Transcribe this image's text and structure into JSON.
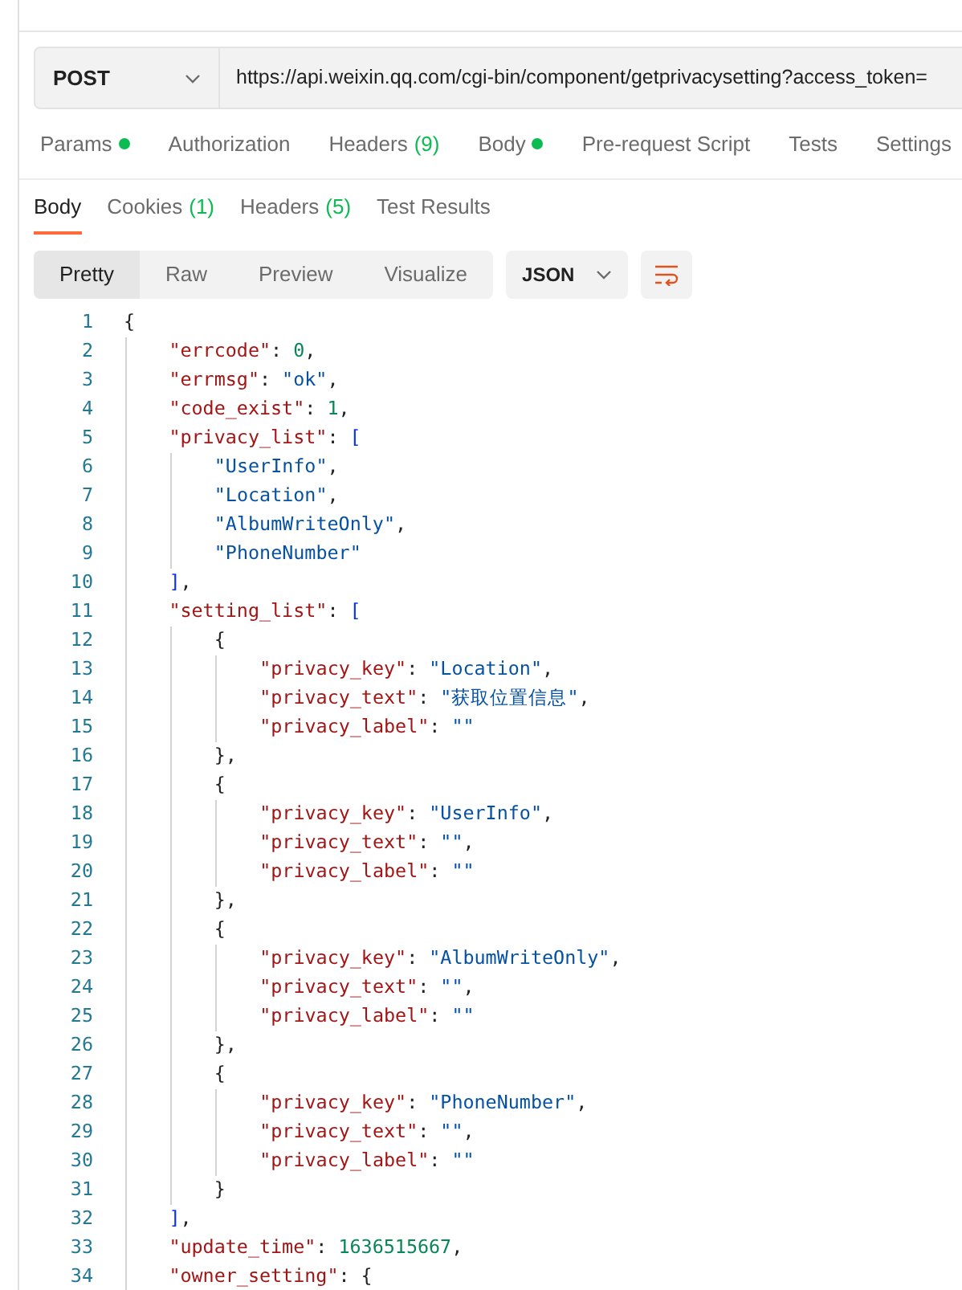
{
  "request": {
    "method": "POST",
    "url": "https://api.weixin.qq.com/cgi-bin/component/getprivacysetting?access_token="
  },
  "request_tabs": [
    {
      "label": "Params",
      "dot": true,
      "selected": false
    },
    {
      "label": "Authorization",
      "dot": false,
      "selected": false
    },
    {
      "label": "Headers",
      "count": "(9)",
      "dot": false,
      "selected": false
    },
    {
      "label": "Body",
      "dot": true,
      "selected": false
    },
    {
      "label": "Pre-request Script",
      "dot": false,
      "selected": false
    },
    {
      "label": "Tests",
      "dot": false,
      "selected": false
    },
    {
      "label": "Settings",
      "dot": false,
      "selected": false
    }
  ],
  "response_tabs": [
    {
      "label": "Body",
      "selected": true
    },
    {
      "label": "Cookies",
      "count": "(1)",
      "selected": false
    },
    {
      "label": "Headers",
      "count": "(5)",
      "selected": false
    },
    {
      "label": "Test Results",
      "selected": false
    }
  ],
  "view_modes": [
    {
      "label": "Pretty",
      "selected": true
    },
    {
      "label": "Raw",
      "selected": false
    },
    {
      "label": "Preview",
      "selected": false
    },
    {
      "label": "Visualize",
      "selected": false
    }
  ],
  "format": "JSON",
  "code_lines": [
    {
      "n": "1",
      "tokens": [
        {
          "kind": "punct",
          "text": "{"
        }
      ],
      "children": [
        {
          "n": "2",
          "tokens": [
            {
              "kind": "key",
              "text": "\"errcode\""
            },
            {
              "kind": "punct",
              "text": ":"
            },
            {
              "kind": "number",
              "text": "0"
            },
            {
              "kind": "punct",
              "text": ","
            }
          ]
        },
        {
          "n": "3",
          "tokens": [
            {
              "kind": "key",
              "text": "\"errmsg\""
            },
            {
              "kind": "punct",
              "text": ":"
            },
            {
              "kind": "string",
              "text": "\"ok\""
            },
            {
              "kind": "punct",
              "text": ","
            }
          ]
        },
        {
          "n": "4",
          "tokens": [
            {
              "kind": "key",
              "text": "\"code_exist\""
            },
            {
              "kind": "punct",
              "text": ":"
            },
            {
              "kind": "number",
              "text": "1"
            },
            {
              "kind": "punct",
              "text": ","
            }
          ]
        },
        {
          "n": "5",
          "tokens": [
            {
              "kind": "key",
              "text": "\"privacy_list\""
            },
            {
              "kind": "punct",
              "text": ":"
            },
            {
              "kind": "bracket",
              "text": "["
            }
          ],
          "children": [
            {
              "n": "6",
              "tokens": [
                {
                  "kind": "string",
                  "text": "\"UserInfo\""
                },
                {
                  "kind": "punct",
                  "text": ","
                }
              ]
            },
            {
              "n": "7",
              "tokens": [
                {
                  "kind": "string",
                  "text": "\"Location\""
                },
                {
                  "kind": "punct",
                  "text": ","
                }
              ]
            },
            {
              "n": "8",
              "tokens": [
                {
                  "kind": "string",
                  "text": "\"AlbumWriteOnly\""
                },
                {
                  "kind": "punct",
                  "text": ","
                }
              ]
            },
            {
              "n": "9",
              "tokens": [
                {
                  "kind": "string",
                  "text": "\"PhoneNumber\""
                }
              ]
            }
          ]
        },
        {
          "n": "10",
          "tokens": [
            {
              "kind": "bracket",
              "text": "]"
            },
            {
              "kind": "punct",
              "text": ","
            }
          ]
        },
        {
          "n": "11",
          "tokens": [
            {
              "kind": "key",
              "text": "\"setting_list\""
            },
            {
              "kind": "punct",
              "text": ":"
            },
            {
              "kind": "bracket",
              "text": "["
            }
          ],
          "children": [
            {
              "n": "12",
              "tokens": [
                {
                  "kind": "punct",
                  "text": "{"
                }
              ],
              "children": [
                {
                  "n": "13",
                  "tokens": [
                    {
                      "kind": "key",
                      "text": "\"privacy_key\""
                    },
                    {
                      "kind": "punct",
                      "text": ":"
                    },
                    {
                      "kind": "string",
                      "text": "\"Location\""
                    },
                    {
                      "kind": "punct",
                      "text": ","
                    }
                  ]
                },
                {
                  "n": "14",
                  "tokens": [
                    {
                      "kind": "key",
                      "text": "\"privacy_text\""
                    },
                    {
                      "kind": "punct",
                      "text": ":"
                    },
                    {
                      "kind": "string",
                      "text": "\"获取位置信息\""
                    },
                    {
                      "kind": "punct",
                      "text": ","
                    }
                  ]
                },
                {
                  "n": "15",
                  "tokens": [
                    {
                      "kind": "key",
                      "text": "\"privacy_label\""
                    },
                    {
                      "kind": "punct",
                      "text": ":"
                    },
                    {
                      "kind": "string",
                      "text": "\"\""
                    }
                  ]
                }
              ]
            },
            {
              "n": "16",
              "tokens": [
                {
                  "kind": "punct",
                  "text": "},"
                }
              ]
            },
            {
              "n": "17",
              "tokens": [
                {
                  "kind": "punct",
                  "text": "{"
                }
              ],
              "children": [
                {
                  "n": "18",
                  "tokens": [
                    {
                      "kind": "key",
                      "text": "\"privacy_key\""
                    },
                    {
                      "kind": "punct",
                      "text": ":"
                    },
                    {
                      "kind": "string",
                      "text": "\"UserInfo\""
                    },
                    {
                      "kind": "punct",
                      "text": ","
                    }
                  ]
                },
                {
                  "n": "19",
                  "tokens": [
                    {
                      "kind": "key",
                      "text": "\"privacy_text\""
                    },
                    {
                      "kind": "punct",
                      "text": ":"
                    },
                    {
                      "kind": "string",
                      "text": "\"\""
                    },
                    {
                      "kind": "punct",
                      "text": ","
                    }
                  ]
                },
                {
                  "n": "20",
                  "tokens": [
                    {
                      "kind": "key",
                      "text": "\"privacy_label\""
                    },
                    {
                      "kind": "punct",
                      "text": ":"
                    },
                    {
                      "kind": "string",
                      "text": "\"\""
                    }
                  ]
                }
              ]
            },
            {
              "n": "21",
              "tokens": [
                {
                  "kind": "punct",
                  "text": "},"
                }
              ]
            },
            {
              "n": "22",
              "tokens": [
                {
                  "kind": "punct",
                  "text": "{"
                }
              ],
              "children": [
                {
                  "n": "23",
                  "tokens": [
                    {
                      "kind": "key",
                      "text": "\"privacy_key\""
                    },
                    {
                      "kind": "punct",
                      "text": ":"
                    },
                    {
                      "kind": "string",
                      "text": "\"AlbumWriteOnly\""
                    },
                    {
                      "kind": "punct",
                      "text": ","
                    }
                  ]
                },
                {
                  "n": "24",
                  "tokens": [
                    {
                      "kind": "key",
                      "text": "\"privacy_text\""
                    },
                    {
                      "kind": "punct",
                      "text": ":"
                    },
                    {
                      "kind": "string",
                      "text": "\"\""
                    },
                    {
                      "kind": "punct",
                      "text": ","
                    }
                  ]
                },
                {
                  "n": "25",
                  "tokens": [
                    {
                      "kind": "key",
                      "text": "\"privacy_label\""
                    },
                    {
                      "kind": "punct",
                      "text": ":"
                    },
                    {
                      "kind": "string",
                      "text": "\"\""
                    }
                  ]
                }
              ]
            },
            {
              "n": "26",
              "tokens": [
                {
                  "kind": "punct",
                  "text": "},"
                }
              ]
            },
            {
              "n": "27",
              "tokens": [
                {
                  "kind": "punct",
                  "text": "{"
                }
              ],
              "children": [
                {
                  "n": "28",
                  "tokens": [
                    {
                      "kind": "key",
                      "text": "\"privacy_key\""
                    },
                    {
                      "kind": "punct",
                      "text": ":"
                    },
                    {
                      "kind": "string",
                      "text": "\"PhoneNumber\""
                    },
                    {
                      "kind": "punct",
                      "text": ","
                    }
                  ]
                },
                {
                  "n": "29",
                  "tokens": [
                    {
                      "kind": "key",
                      "text": "\"privacy_text\""
                    },
                    {
                      "kind": "punct",
                      "text": ":"
                    },
                    {
                      "kind": "string",
                      "text": "\"\""
                    },
                    {
                      "kind": "punct",
                      "text": ","
                    }
                  ]
                },
                {
                  "n": "30",
                  "tokens": [
                    {
                      "kind": "key",
                      "text": "\"privacy_label\""
                    },
                    {
                      "kind": "punct",
                      "text": ":"
                    },
                    {
                      "kind": "string",
                      "text": "\"\""
                    }
                  ]
                }
              ]
            },
            {
              "n": "31",
              "tokens": [
                {
                  "kind": "punct",
                  "text": "}"
                }
              ]
            }
          ]
        },
        {
          "n": "32",
          "tokens": [
            {
              "kind": "bracket",
              "text": "]"
            },
            {
              "kind": "punct",
              "text": ","
            }
          ]
        },
        {
          "n": "33",
          "tokens": [
            {
              "kind": "key",
              "text": "\"update_time\""
            },
            {
              "kind": "punct",
              "text": ":"
            },
            {
              "kind": "number",
              "text": "1636515667"
            },
            {
              "kind": "punct",
              "text": ","
            }
          ]
        },
        {
          "n": "34",
          "tokens": [
            {
              "kind": "key",
              "text": "\"owner_setting\""
            },
            {
              "kind": "punct",
              "text": ":"
            },
            {
              "kind": "punct",
              "text": "{"
            }
          ]
        }
      ]
    }
  ]
}
